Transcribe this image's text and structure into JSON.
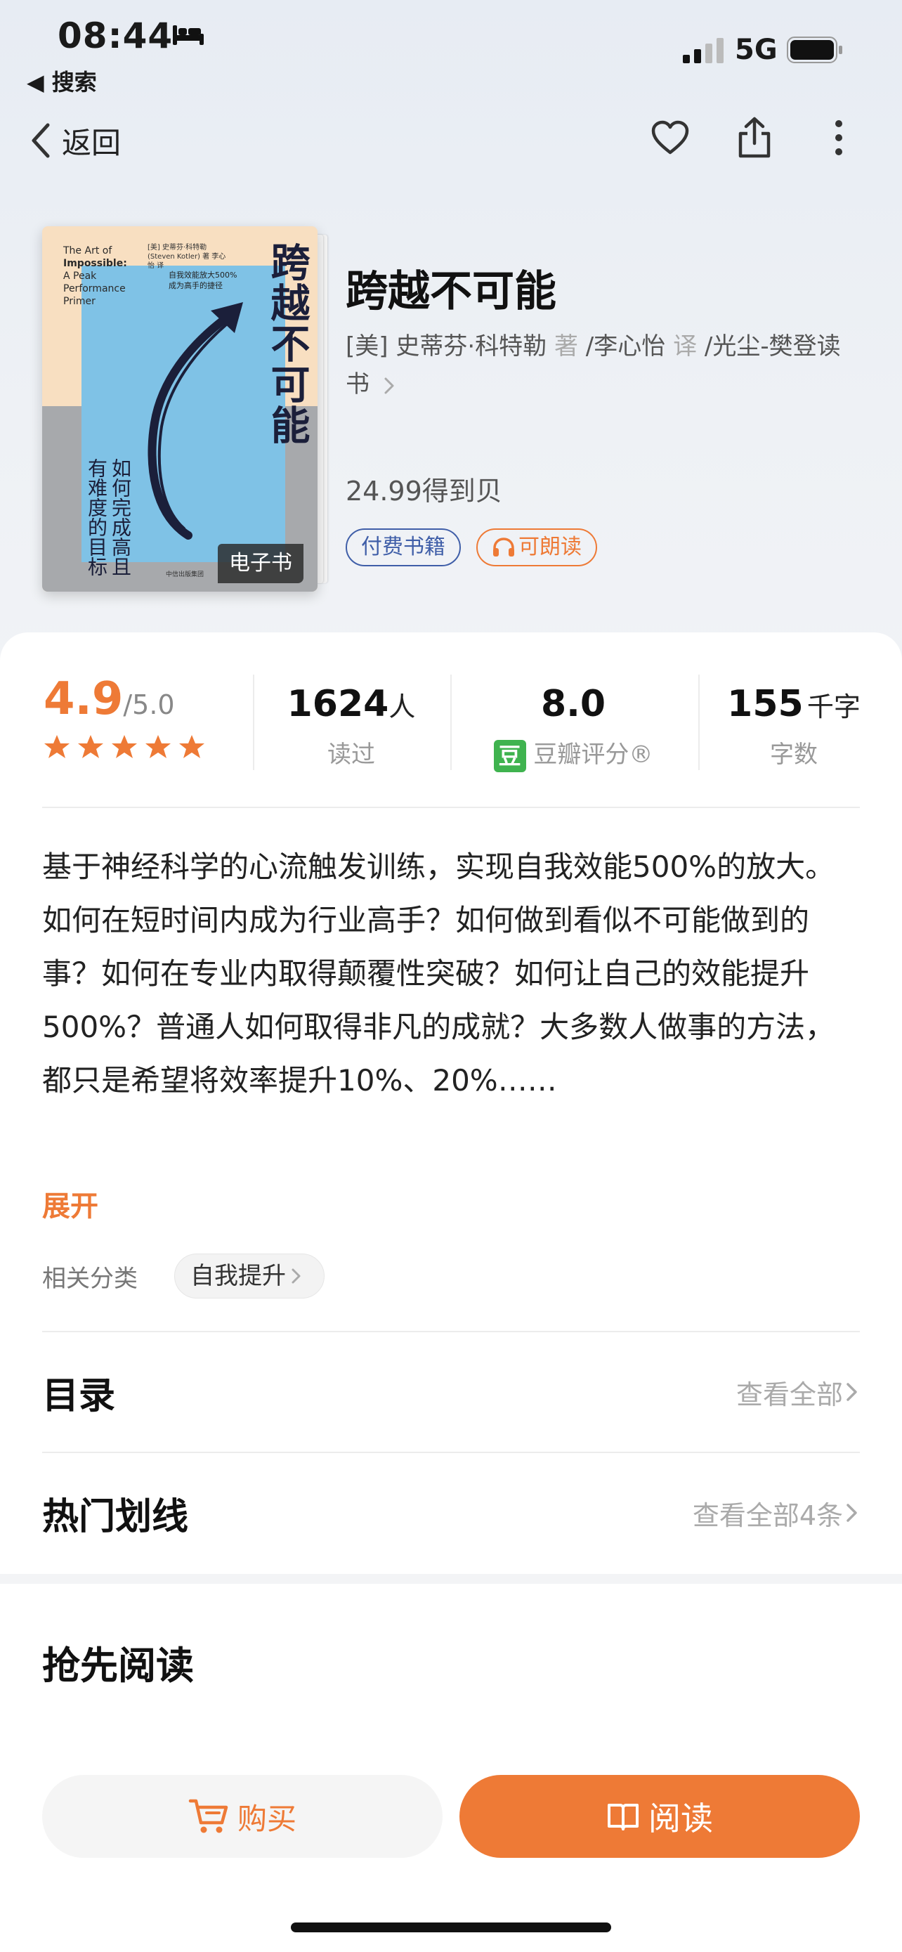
{
  "status_bar": {
    "time": "08:44",
    "back_app": "◀ 搜索",
    "network": "5G"
  },
  "nav": {
    "back_label": "返回",
    "icons": [
      "heart-icon",
      "share-icon",
      "more-icon"
    ]
  },
  "cover": {
    "title_cn": "跨越不可能",
    "title_en_1": "The Art of",
    "title_en_2": "Impossible:",
    "title_en_3": "A Peak Performance Primer",
    "author_cn": "[美] 史蒂芬·科特勒 (Steven Kotler) 著  李心怡 译",
    "tagline": "自我效能放大500% 成为高手的捷径",
    "subtitle": "如何完成高且有难度的目标",
    "publisher": "中信出版集团",
    "badge": "电子书"
  },
  "book": {
    "title": "跨越不可能",
    "author": "[美] 史蒂芬·科特勒",
    "author_role": "著",
    "translator": "/李心怡",
    "translator_role": "译",
    "publisher": "/光尘-樊登读书",
    "price": "24.99得到贝",
    "tags": [
      "付费书籍",
      "可朗读"
    ]
  },
  "stats": {
    "rating": "4.9",
    "rating_max": "/5.0",
    "stars": 5,
    "readers": "1624",
    "readers_unit": "人",
    "readers_label": "读过",
    "douban_score": "8.0",
    "douban_logo": "豆",
    "douban_label": "豆瓣评分®",
    "words": "155",
    "words_unit": "千字",
    "words_label": "字数"
  },
  "description": {
    "line1": "基于神经科学的心流触发训练，实现自我效能500%的放大。",
    "line2": "如何在短时间内成为行业高手？如何做到看似不可能做到的事？如何在专业内取得颠覆性突破？如何让自己的效能提升500%？普通人如何取得非凡的成就？大多数人做事的方法，都只是希望将效率提升10%、20%……",
    "expand": "展开"
  },
  "category": {
    "label": "相关分类",
    "chip": "自我提升"
  },
  "sections": {
    "toc_title": "目录",
    "toc_more": "查看全部",
    "highlights_title": "热门划线",
    "highlights_more": "查看全部4条",
    "preread_title": "抢先阅读"
  },
  "actions": {
    "buy": "购买",
    "read": "阅读"
  },
  "colors": {
    "accent": "#ee7a36",
    "tag_blue": "#3f5ea8",
    "douban_green": "#3fb34f"
  }
}
